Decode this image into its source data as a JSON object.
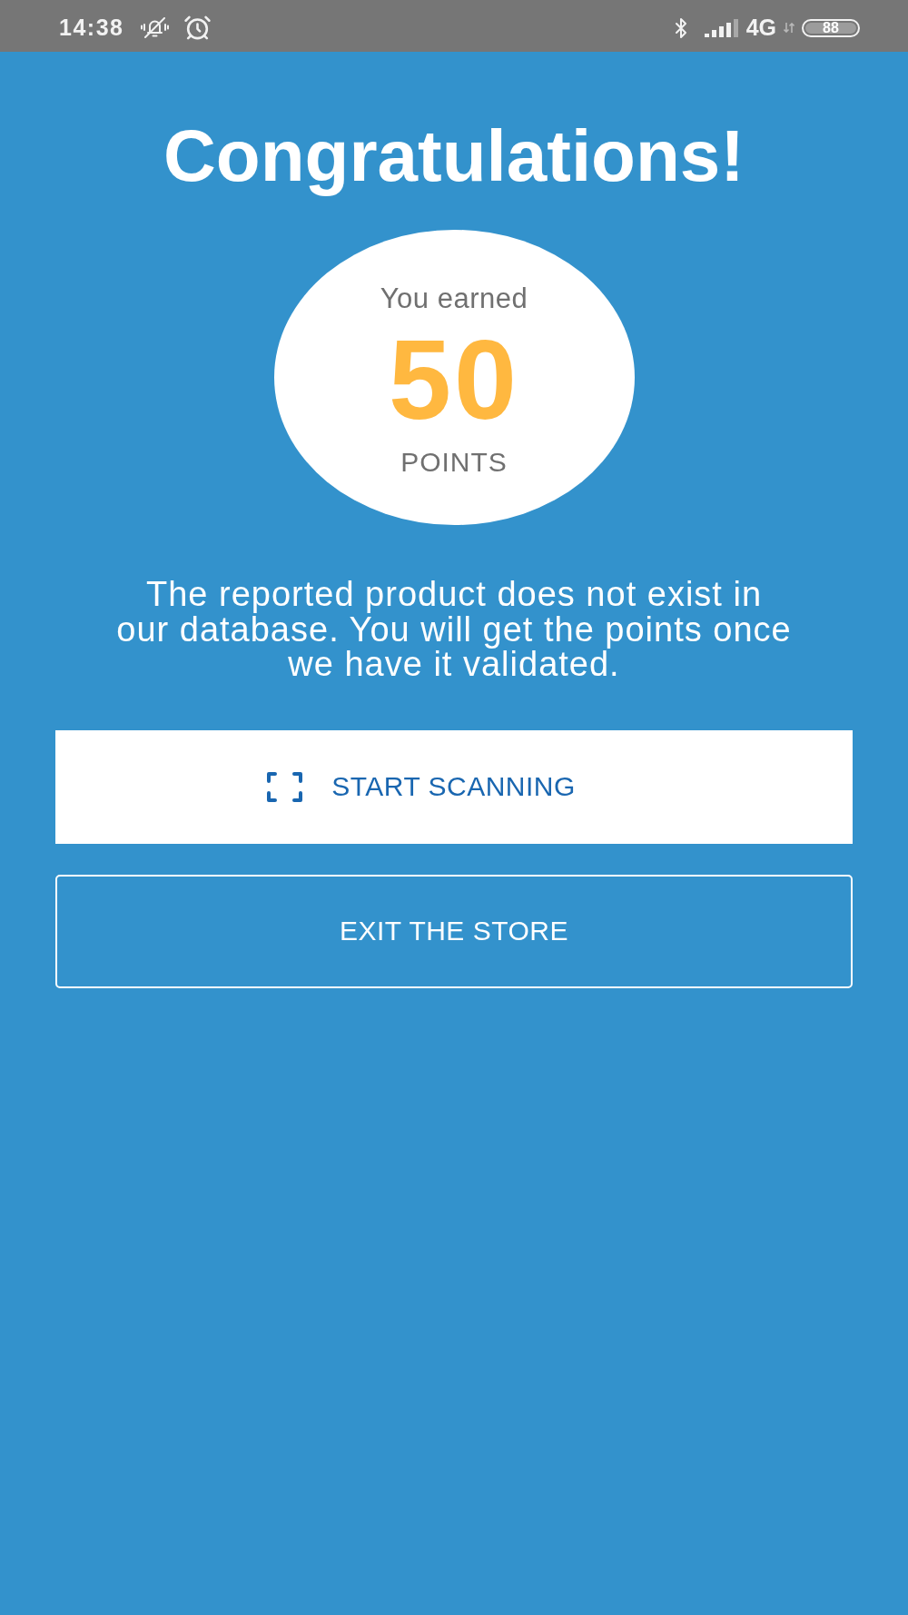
{
  "status_bar": {
    "time": "14:38",
    "network": "4G",
    "battery": "88"
  },
  "title": "Congratulations!",
  "reward": {
    "caption": "You earned",
    "points": "50",
    "unit": "POINTS"
  },
  "message": "The reported product does not exist in\nour database. You will get the points once\nwe have it validated.",
  "buttons": [
    {
      "kind": "primary",
      "label": "START SCANNING"
    },
    {
      "kind": "outline",
      "label": "EXIT THE STORE"
    }
  ]
}
